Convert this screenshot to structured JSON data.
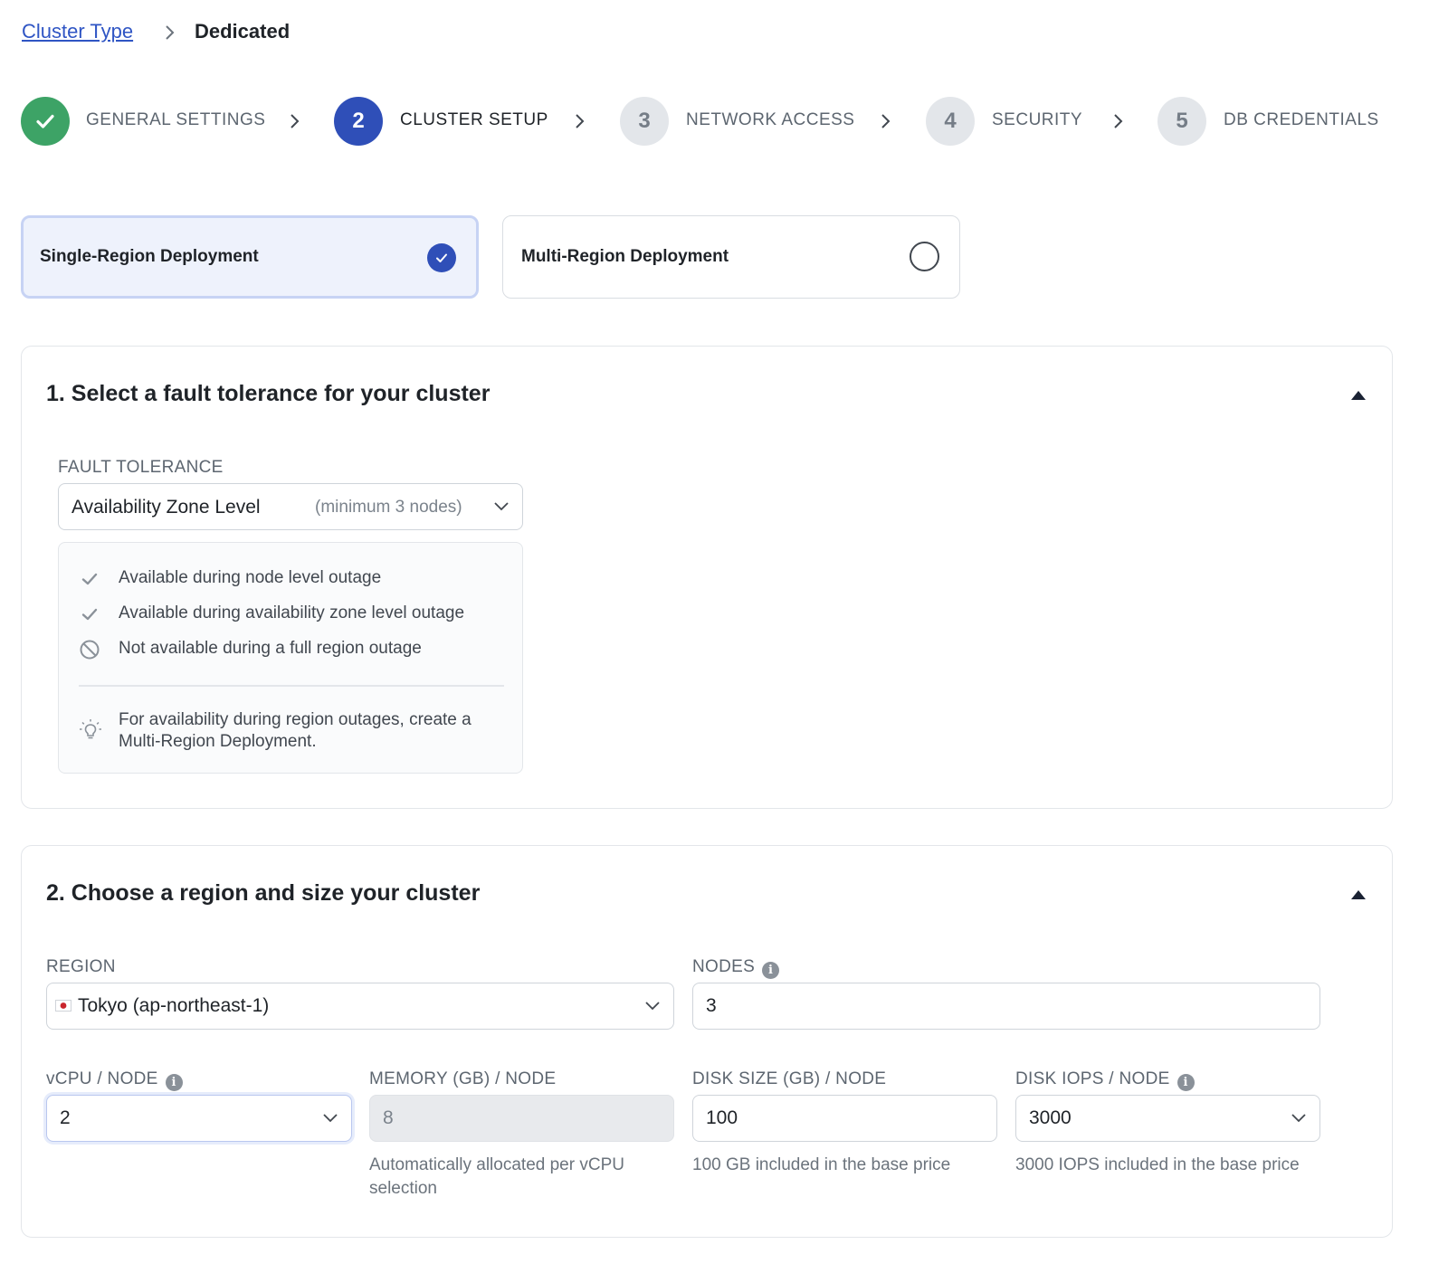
{
  "breadcrumb": {
    "parent": "Cluster Type",
    "current": "Dedicated"
  },
  "stepper": [
    {
      "number": "",
      "label": "GENERAL SETTINGS",
      "state": "done"
    },
    {
      "number": "2",
      "label": "CLUSTER SETUP",
      "state": "active"
    },
    {
      "number": "3",
      "label": "NETWORK ACCESS",
      "state": "todo"
    },
    {
      "number": "4",
      "label": "SECURITY",
      "state": "todo"
    },
    {
      "number": "5",
      "label": "DB CREDENTIALS",
      "state": "todo"
    }
  ],
  "deployment": {
    "single": {
      "label": "Single-Region Deployment",
      "selected": true
    },
    "multi": {
      "label": "Multi-Region Deployment",
      "selected": false
    }
  },
  "fault_section": {
    "title": "1. Select a fault tolerance for your cluster",
    "field_label": "FAULT TOLERANCE",
    "select_value": "Availability Zone Level",
    "select_hint": "(minimum 3 nodes)",
    "items": [
      {
        "icon": "check-icon",
        "text": "Available during node level outage"
      },
      {
        "icon": "check-icon",
        "text": "Available during availability zone level outage"
      },
      {
        "icon": "ban-icon",
        "text": "Not available during a full region outage"
      }
    ],
    "tip_icon": "lightbulb-icon",
    "tip_line1": "For availability during region outages, create a",
    "tip_line2": "Multi-Region Deployment."
  },
  "region_section": {
    "title": "2. Choose a region and size your cluster",
    "region": {
      "label": "REGION",
      "value": "Tokyo (ap-northeast-1)",
      "flag_icon": "japan-flag-icon"
    },
    "nodes": {
      "label": "NODES",
      "value": "3"
    },
    "vcpu": {
      "label": "vCPU / NODE",
      "value": "2"
    },
    "memory": {
      "label": "MEMORY (GB) / NODE",
      "value": "8",
      "helper_line1": "Automatically allocated per vCPU",
      "helper_line2": "selection"
    },
    "disk_size": {
      "label": "DISK SIZE (GB) / NODE",
      "value": "100",
      "helper": "100 GB included in the base price"
    },
    "disk_iops": {
      "label": "DISK IOPS / NODE",
      "value": "3000",
      "helper": "3000 IOPS included in the base price"
    }
  },
  "colors": {
    "accent": "#2f4fb8",
    "success": "#3da366",
    "link": "#2f55c4"
  }
}
